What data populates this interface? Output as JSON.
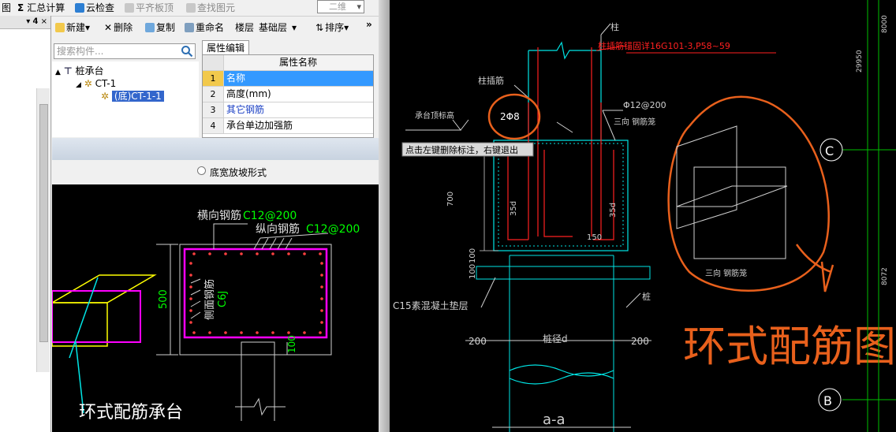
{
  "toolbar": {
    "item0": "图",
    "item1": "汇总计算",
    "item2": "云检查",
    "item3": "平齐板顶",
    "item4": "查找图元",
    "view_mode": "二维"
  },
  "left_pane": {
    "pin_glyphs": "▾ 𝟰 ×"
  },
  "component_toolbar": {
    "new": "新建",
    "delete": "删除",
    "copy": "复制",
    "rename": "重命名",
    "floor_label": "楼层",
    "floor_value": "基础层",
    "sort": "排序"
  },
  "search": {
    "placeholder": "搜索构件..."
  },
  "tree": {
    "root": "桩承台",
    "child": "CT-1",
    "leaf": "(底)CT-1-1"
  },
  "properties": {
    "tab": "属性编辑",
    "column_header": "属性名称",
    "rows": [
      {
        "num": "1",
        "name": "名称"
      },
      {
        "num": "2",
        "name": "高度(mm)"
      },
      {
        "num": "3",
        "name": "其它钢筋"
      },
      {
        "num": "4",
        "name": "承台单边加强筋"
      }
    ]
  },
  "option": {
    "label": "底宽放坡形式"
  },
  "preview": {
    "hbar_label": "横向钢筋",
    "hbar_spec": "C12@200",
    "vbar_label": "纵向钢筋",
    "vbar_spec": "C12@200",
    "side_label": "侧面钢筋",
    "side_spec": "C6J",
    "dim_500": "500",
    "dim_100": "100",
    "caption": "环式配筋承台"
  },
  "cad": {
    "column": "柱",
    "anchor_note": "柱插筋锚固详16G101-3,P58~59",
    "pile_bar": "柱插筋",
    "bars_2": "2Φ8",
    "top_elev": "承台顶标高",
    "stirrup": "Φ12@200",
    "three_way_1": "三向 钢筋笼",
    "tooltip": "点击左键删除标注，右键退出",
    "dim_700": "700",
    "dim_35d_a": "35d",
    "dim_35d_b": "35d",
    "dim_150": "150",
    "dim_100": "100",
    "dim_100b": "100",
    "cushion": "C15素混凝土垫层",
    "pile": "桩",
    "pile_dia": "桩径d",
    "dim_200a": "200",
    "dim_200b": "200",
    "section": "a-a",
    "three_way_2": "三向 钢筋笼",
    "big_title": "环式配筋图",
    "axis_c": "C",
    "axis_b": "B",
    "dim_8000": "8000",
    "dim_29950": "29950",
    "dim_8072": "8072"
  },
  "colors": {
    "cad_bg": "#000000",
    "cyan": "#00e5e5",
    "red": "#ff2020",
    "orange": "#e8601c",
    "green": "#00ff00",
    "magenta": "#ff00ff",
    "yellow": "#ffff00",
    "selection": "#3366cc"
  }
}
